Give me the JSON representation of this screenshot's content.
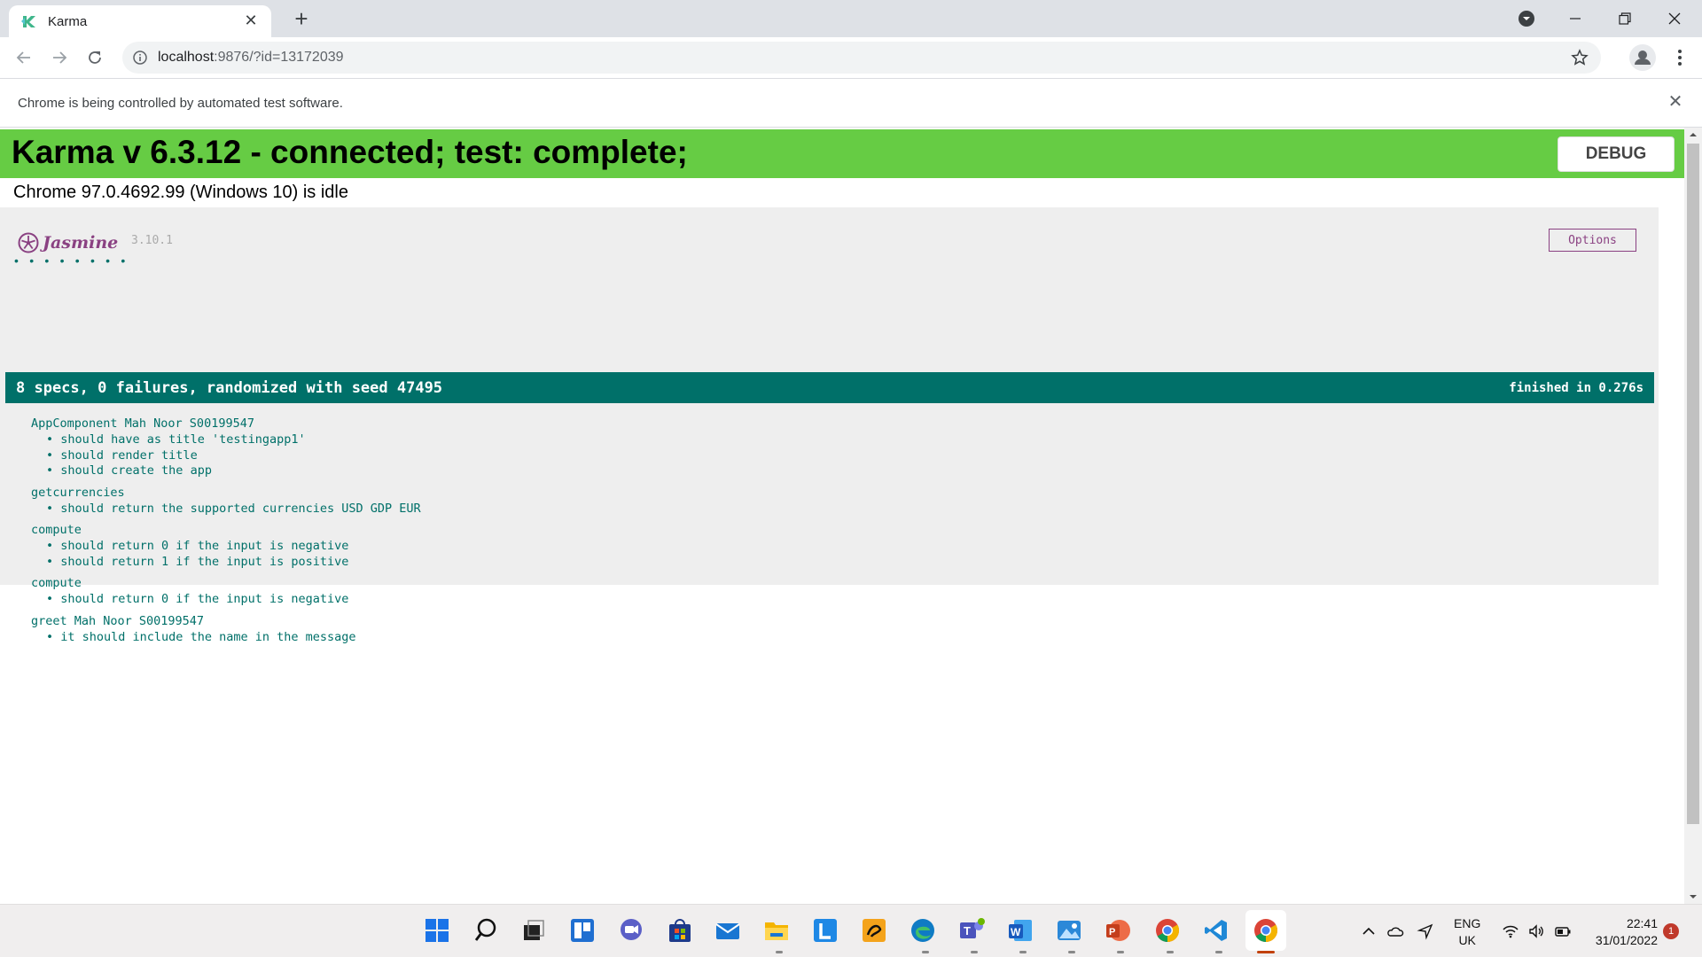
{
  "browser": {
    "tab_title": "Karma",
    "url_host": "localhost",
    "url_rest": ":9876/?id=13172039",
    "infobar_text": "Chrome is being controlled by automated test software."
  },
  "karma": {
    "banner_title": "Karma v 6.3.12 - connected; test: complete;",
    "debug_label": "DEBUG",
    "status_line": "Chrome 97.0.4692.99 (Windows 10) is idle",
    "banner_color": "#66cc44"
  },
  "jasmine": {
    "name": "Jasmine",
    "version": "3.10.1",
    "options_label": "Options",
    "spec_dot_count": 8,
    "summary": "8 specs, 0 failures, randomized with seed 47495",
    "duration": "finished in 0.276s",
    "accent_color": "#007069",
    "suites": [
      {
        "title": "AppComponent Mah Noor S00199547",
        "specs": [
          "should have as title 'testingapp1'",
          "should render title",
          "should create the app"
        ]
      },
      {
        "title": "getcurrencies",
        "specs": [
          "should return the supported currencies USD GDP EUR"
        ]
      },
      {
        "title": "compute",
        "specs": [
          "should return 0 if the input is negative",
          "should return 1 if the input is positive"
        ]
      },
      {
        "title": "compute",
        "specs": [
          "should return 0 if the input is negative"
        ]
      },
      {
        "title": "greet Mah Noor S00199547",
        "specs": [
          "it should include the name in the message"
        ]
      }
    ]
  },
  "taskbar": {
    "pinned": [
      "start-icon",
      "search-icon",
      "task-view-icon",
      "widgets-icon",
      "chat-icon",
      "store-icon",
      "mail-icon",
      "file-explorer-icon",
      "l-app-icon",
      "paint-app-icon",
      "edge-icon",
      "teams-icon",
      "word-icon",
      "photos-icon",
      "powerpoint-icon",
      "chrome-icon",
      "vscode-icon",
      "chrome-active-icon"
    ],
    "language_line1": "ENG",
    "language_line2": "UK",
    "time": "22:41",
    "date": "31/01/2022",
    "notification_count": "1"
  }
}
